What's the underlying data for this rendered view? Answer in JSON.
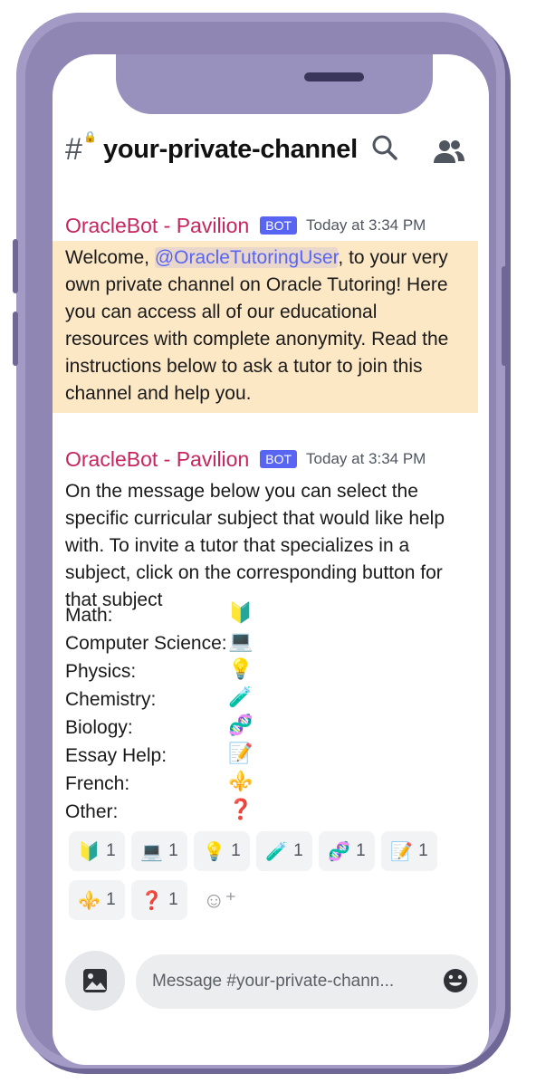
{
  "header": {
    "channel_icon": "hash-lock-icon",
    "channel_name": "your-private-channel",
    "search_icon": "search-icon",
    "members_icon": "members-icon"
  },
  "messages": [
    {
      "author": "OracleBot - Pavilion",
      "badge": "BOT",
      "timestamp": "Today at 3:34 PM",
      "text_before": "Welcome, ",
      "mention": "@OracleTutoringUser",
      "text_after": ", to your very own private channel on Oracle Tutoring! Here you can access all of our educational resources with complete anonymity. Read the instructions below to ask a tutor to join this channel and help you."
    },
    {
      "author": "OracleBot - Pavilion",
      "badge": "BOT",
      "timestamp": "Today at 3:34 PM",
      "text": "On the message below you can select the specific curricular subject that would like help with. To invite a tutor that specializes in a subject, click on the corresponding button for that subject"
    }
  ],
  "subjects": [
    {
      "label": "Math:",
      "emoji": "🔰",
      "icon": "beginner-icon"
    },
    {
      "label": "Computer Science:",
      "emoji": "💻",
      "icon": "computer-icon"
    },
    {
      "label": "Physics:",
      "emoji": "💡",
      "icon": "lightbulb-icon"
    },
    {
      "label": "Chemistry:",
      "emoji": "🧪",
      "icon": "test-tube-icon"
    },
    {
      "label": "Biology:",
      "emoji": "🧬",
      "icon": "dna-icon"
    },
    {
      "label": "Essay Help:",
      "emoji": "📝",
      "icon": "memo-icon"
    },
    {
      "label": "French:",
      "emoji": "⚜️",
      "icon": "fleur-de-lis-icon"
    },
    {
      "label": "Other:",
      "emoji": "❓",
      "icon": "question-icon"
    }
  ],
  "reactions": [
    {
      "emoji": "🔰",
      "count": "1"
    },
    {
      "emoji": "💻",
      "count": "1"
    },
    {
      "emoji": "💡",
      "count": "1"
    },
    {
      "emoji": "🧪",
      "count": "1"
    },
    {
      "emoji": "🧬",
      "count": "1"
    },
    {
      "emoji": "📝",
      "count": "1"
    },
    {
      "emoji": "⚜️",
      "count": "1"
    },
    {
      "emoji": "❓",
      "count": "1"
    }
  ],
  "composer": {
    "placeholder": "Message #your-private-chann..."
  },
  "colors": {
    "author": "#c7255d",
    "bot_badge": "#5865f2",
    "highlight": "#fde8c6",
    "phone_frame": "#8f86b3"
  }
}
